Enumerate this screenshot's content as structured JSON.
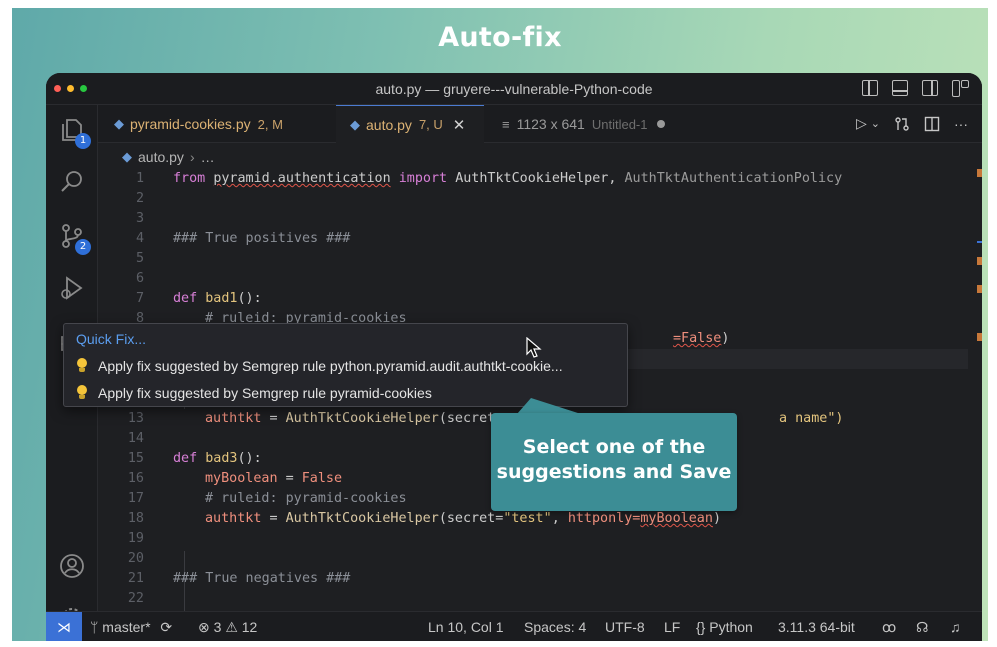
{
  "headline": "Auto-fix",
  "window": {
    "title": "auto.py — gruyere---vulnerable-Python-code"
  },
  "activity": {
    "explorer_badge": "1",
    "scm_badge": "2"
  },
  "tabs": [
    {
      "label": "pyramid-cookies.py",
      "status": "2, M"
    },
    {
      "label": "auto.py",
      "status": "7, U"
    },
    {
      "label": "1123 x 641",
      "sub": "Untitled-1"
    }
  ],
  "tab_actions": {
    "run": "▷",
    "run_dropdown": "⌄",
    "more": "···"
  },
  "breadcrumb": {
    "file": "auto.py",
    "rest": "…"
  },
  "code": {
    "line_numbers": [
      "1",
      "2",
      "3",
      "4",
      "5",
      "6",
      "7",
      "8",
      "9",
      "10",
      "11",
      "12",
      "13",
      "14",
      "15",
      "16",
      "17",
      "18",
      "19",
      "20",
      "21",
      "22"
    ],
    "l1": {
      "kw1": "from",
      "mod": "pyramid.authentication",
      "kw2": "import",
      "c1": "AuthTktCookieHelper",
      "comma": ",",
      "c2": "AuthTktAuthenticationPolicy"
    },
    "l4": "### True positives ###",
    "l7": {
      "kw": "def",
      "fn": "bad1",
      "rest": "():"
    },
    "l8": "# ruleid: pyramid-cookies",
    "l9": {
      "tail_kw": "=False",
      "tail_rest": ")"
    },
    "l13": {
      "var": "authtkt",
      "eq": " = ",
      "cls": "AuthTktCookieHelper",
      "open": "(secret=",
      "tail": "a name\")"
    },
    "l15": {
      "kw": "def",
      "fn": "bad3",
      "rest": "():"
    },
    "l16": {
      "var": "myBoolean",
      "eq": " = ",
      "val": "False"
    },
    "l17": "# ruleid: pyramid-cookies",
    "l18": {
      "var": "authtkt",
      "eq": " = ",
      "cls": "AuthTktCookieHelper",
      "open": "(secret=",
      "str": "\"test\"",
      "mid": ", ",
      "kw": "httponly=",
      "arg": "myBoolean",
      "close": ")"
    },
    "l21": "### True negatives ###"
  },
  "quick_fix": {
    "title": "Quick Fix...",
    "items": [
      "Apply fix suggested by Semgrep rule python.pyramid.audit.authtkt-cookie...",
      "Apply fix suggested by Semgrep rule pyramid-cookies"
    ]
  },
  "callout": {
    "line1": "Select one of the",
    "line2": "suggestions and Save"
  },
  "status_bar": {
    "remote": "⋊",
    "branch": "master*",
    "sync": "⟳",
    "errors": "3",
    "warnings": "12",
    "position": "Ln 10, Col 1",
    "spaces": "Spaces: 4",
    "encoding": "UTF-8",
    "eol": "LF",
    "language": "Python",
    "interpreter": "3.11.3 64-bit"
  },
  "colors": {
    "accent": "#3b71d6",
    "callout": "#3c8d95",
    "background_gradient_start": "#5fa9a9",
    "background_gradient_end": "#bfe3b9"
  }
}
